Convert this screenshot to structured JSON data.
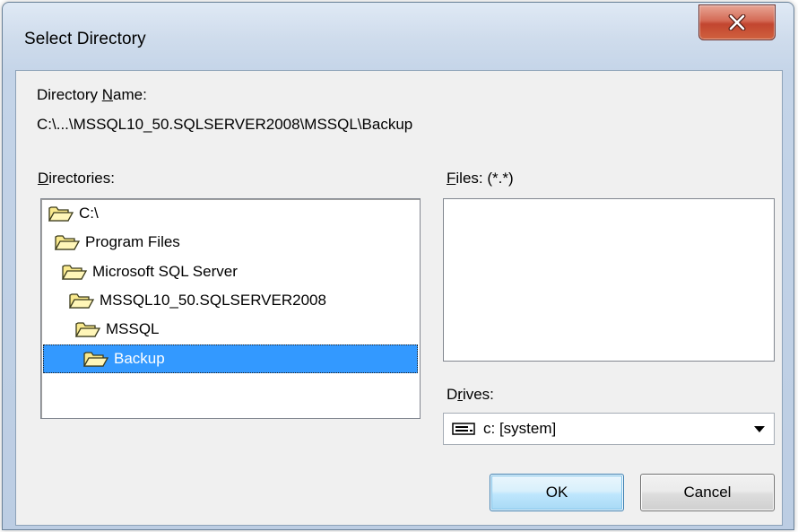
{
  "window": {
    "title": "Select Directory",
    "close_icon": "close-icon"
  },
  "directory_name": {
    "label_pre": "Directory ",
    "label_accel": "N",
    "label_post": "ame:",
    "value": "C:\\...\\MSSQL10_50.SQLSERVER2008\\MSSQL\\Backup"
  },
  "directories": {
    "label_accel": "D",
    "label_post": "irectories:",
    "items": [
      {
        "label": "C:\\",
        "icon": "open-folder-icon",
        "selected": false
      },
      {
        "label": "Program Files",
        "icon": "open-folder-icon",
        "selected": false
      },
      {
        "label": "Microsoft SQL Server",
        "icon": "open-folder-icon",
        "selected": false
      },
      {
        "label": "MSSQL10_50.SQLSERVER2008",
        "icon": "open-folder-icon",
        "selected": false
      },
      {
        "label": "MSSQL",
        "icon": "open-folder-icon",
        "selected": false
      },
      {
        "label": "Backup",
        "icon": "open-folder-icon",
        "selected": true
      }
    ]
  },
  "files": {
    "label_accel": "F",
    "label_post": "iles: (*.*)",
    "items": []
  },
  "drives": {
    "label_pre": "D",
    "label_accel": "r",
    "label_post": "ives:",
    "selected": "c: [system]",
    "icon": "drive-icon"
  },
  "buttons": {
    "ok_label": "OK",
    "cancel_label": "Cancel"
  },
  "colors": {
    "selection": "#3399ff",
    "close_button": "#c2452f",
    "folder_fill": "#f9e98d"
  }
}
